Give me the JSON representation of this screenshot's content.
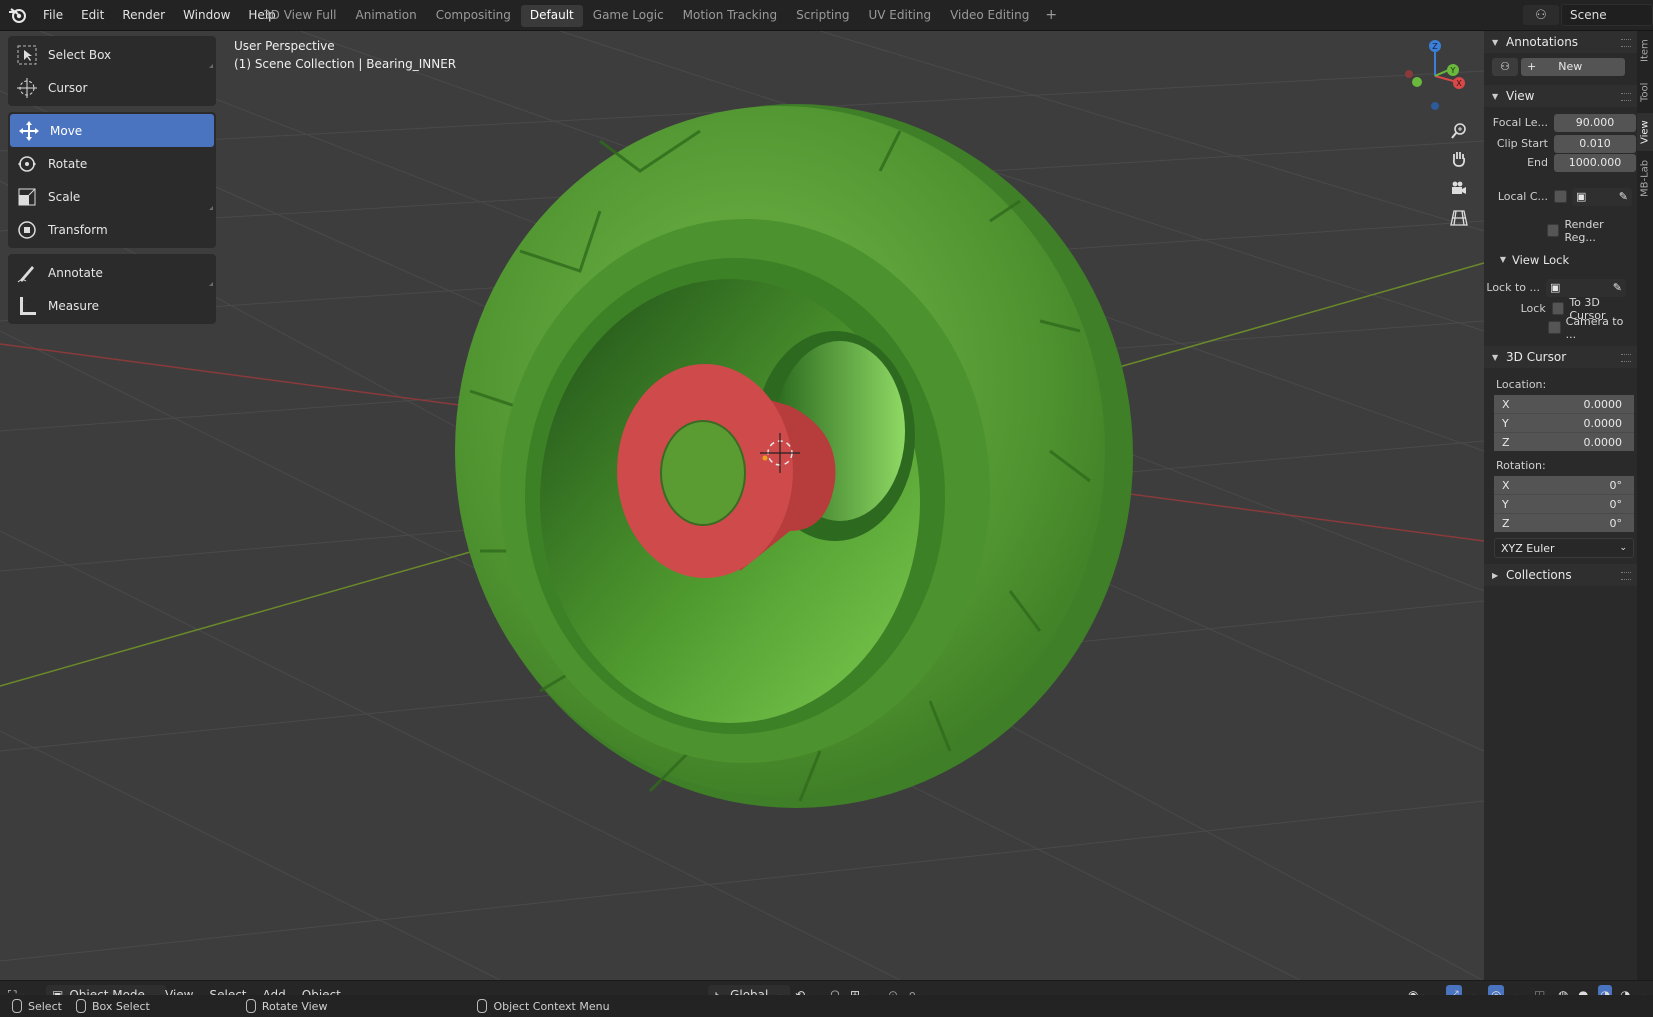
{
  "menu": [
    "File",
    "Edit",
    "Render",
    "Window",
    "Help"
  ],
  "workspaces": [
    {
      "label": "3D View Full",
      "active": false
    },
    {
      "label": "Animation",
      "active": false
    },
    {
      "label": "Compositing",
      "active": false
    },
    {
      "label": "Default",
      "active": true
    },
    {
      "label": "Game Logic",
      "active": false
    },
    {
      "label": "Motion Tracking",
      "active": false
    },
    {
      "label": "Scripting",
      "active": false
    },
    {
      "label": "UV Editing",
      "active": false
    },
    {
      "label": "Video Editing",
      "active": false
    }
  ],
  "add_workspace": "+",
  "scene": "Scene",
  "tools": [
    {
      "label": "Select Box",
      "icon": "select-box-icon"
    },
    {
      "label": "Cursor",
      "icon": "cursor-icon"
    },
    {
      "label": "Move",
      "icon": "move-icon",
      "active": true
    },
    {
      "label": "Rotate",
      "icon": "rotate-icon"
    },
    {
      "label": "Scale",
      "icon": "scale-icon"
    },
    {
      "label": "Transform",
      "icon": "transform-icon"
    },
    {
      "label": "Annotate",
      "icon": "annotate-icon"
    },
    {
      "label": "Measure",
      "icon": "measure-icon"
    }
  ],
  "viewport": {
    "line1": "User Perspective",
    "line2": "(1) Scene Collection | Bearing_INNER"
  },
  "npanel": {
    "tabs": [
      "Item",
      "Tool",
      "View",
      "MB-Lab"
    ],
    "annotations": {
      "title": "Annotations",
      "new_label": "New"
    },
    "view": {
      "title": "View",
      "focal_label": "Focal Le...",
      "focal_value": "90.000",
      "clip_start_label": "Clip Start",
      "clip_start_value": "0.010",
      "end_label": "End",
      "end_value": "1000.000",
      "local_camera_label": "Local C...",
      "render_region_label": "Render Reg...",
      "view_lock_title": "View Lock",
      "lock_to_label": "Lock to ...",
      "lock_label": "Lock",
      "to_3d_cursor": "To 3D Cursor",
      "camera_to": "Camera to ..."
    },
    "cursor": {
      "title": "3D Cursor",
      "location_label": "Location:",
      "loc": [
        {
          "axis": "X",
          "value": "0.0000"
        },
        {
          "axis": "Y",
          "value": "0.0000"
        },
        {
          "axis": "Z",
          "value": "0.0000"
        }
      ],
      "rotation_label": "Rotation:",
      "rot": [
        {
          "axis": "X",
          "value": "0°"
        },
        {
          "axis": "Y",
          "value": "0°"
        },
        {
          "axis": "Z",
          "value": "0°"
        }
      ],
      "rot_mode": "XYZ Euler"
    },
    "collections": {
      "title": "Collections"
    }
  },
  "header": {
    "mode": "Object Mode",
    "menus": [
      "View",
      "Select",
      "Add",
      "Object"
    ],
    "orientation": "Global"
  },
  "status": {
    "select": "Select",
    "box_select": "Box Select",
    "rotate_view": "Rotate View",
    "context_menu": "Object Context Menu"
  },
  "colors": {
    "wheel": "#5a9e35",
    "bearing": "#cf4a4a",
    "active_tool": "#4a74c0",
    "viewport_bg": "#3d3d3d"
  }
}
